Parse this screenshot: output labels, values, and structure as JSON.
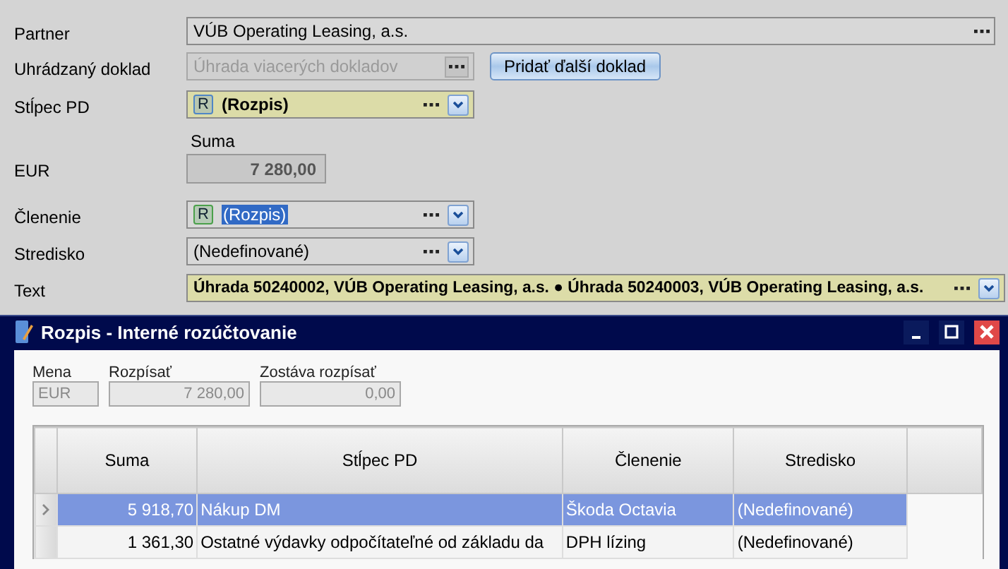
{
  "form": {
    "partner": {
      "label": "Partner",
      "value": "VÚB Operating Leasing, a.s."
    },
    "paid_document": {
      "label": "Uhrádzaný doklad",
      "value": "Úhrada viacerých dokladov",
      "disabled": true,
      "button": "Pridať ďalší doklad"
    },
    "column_pd": {
      "label": "Stĺpec PD",
      "value": "(Rozpis)",
      "highlighted": true,
      "badge": {
        "text": "R",
        "color": "#4f86c6"
      }
    },
    "amount": {
      "caption": "Suma",
      "label": "EUR",
      "value": "7 280,00"
    },
    "breakdown": {
      "label": "Členenie",
      "value": "(Rozpis)",
      "highlighted": false,
      "text_selected": true,
      "badge": {
        "text": "R",
        "color": "#4aa04a"
      }
    },
    "center": {
      "label": "Stredisko",
      "value": "(Nedefinované)",
      "highlighted": false
    },
    "text": {
      "label": "Text",
      "value": "Úhrada 50240002, VÚB Operating Leasing, a.s. ● Úhrada 50240003, VÚB Operating Leasing, a.s.",
      "highlighted": true
    }
  },
  "dialog": {
    "title": "Rozpis - Interné rozúčtovanie",
    "summary": [
      {
        "label": "Mena",
        "value": "EUR",
        "kind": "text"
      },
      {
        "label": "Rozpísať",
        "value": "7 280,00",
        "kind": "number"
      },
      {
        "label": "Zostáva rozpísať",
        "value": "0,00",
        "kind": "number"
      }
    ],
    "table": {
      "columns": [
        "Suma",
        "Stĺpec PD",
        "Členenie",
        "Stredisko"
      ],
      "rows": [
        {
          "cells": [
            "5 918,70",
            "Nákup DM",
            "Škoda Octavia",
            "(Nedefinované)"
          ],
          "selected": true
        },
        {
          "cells": [
            "1 361,30",
            "Ostatné výdavky odpočítateľné od základu da",
            "DPH lízing",
            "(Nedefinované)"
          ],
          "selected": false
        }
      ]
    }
  }
}
